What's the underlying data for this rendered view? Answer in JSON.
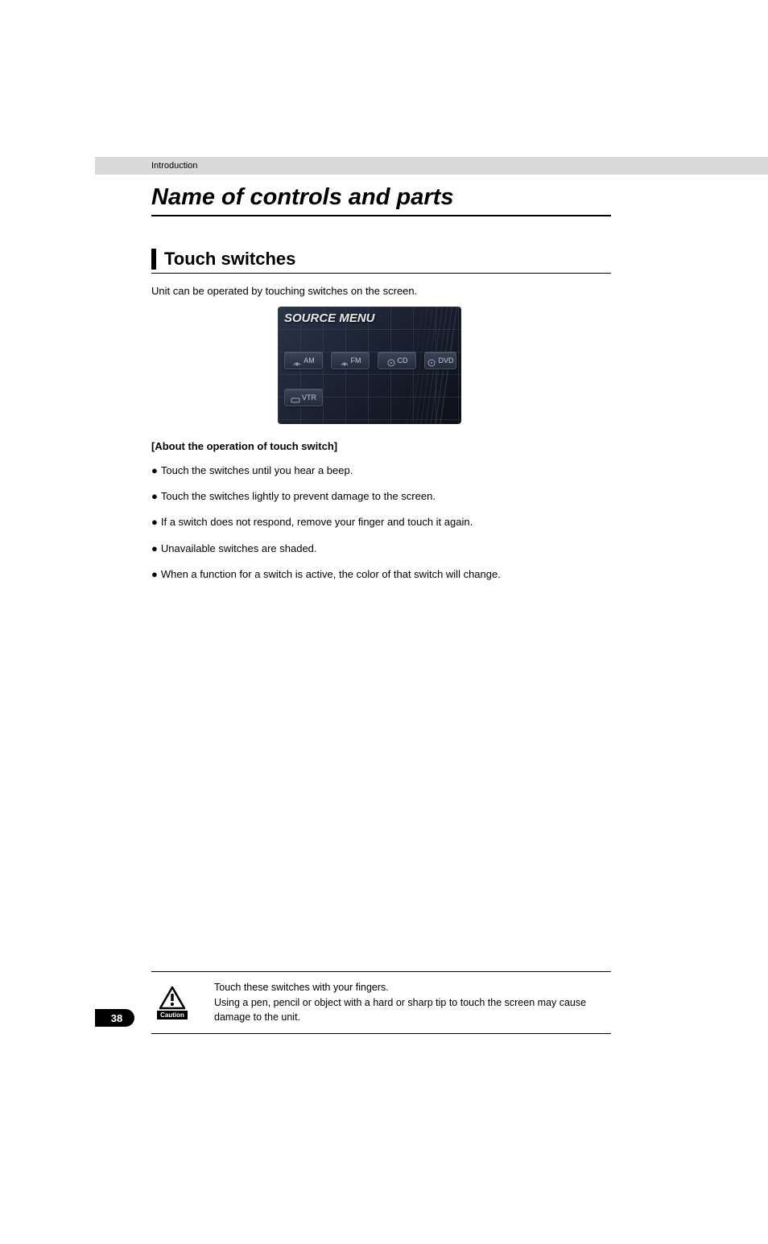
{
  "breadcrumb": "Introduction",
  "title": "Name of controls and parts",
  "section_title": "Touch switches",
  "intro": "Unit can be operated by touching switches on the screen.",
  "screen": {
    "title": "SOURCE MENU",
    "buttons": {
      "am": "AM",
      "fm": "FM",
      "cd": "CD",
      "dvd": "DVD",
      "vtr": "VTR"
    }
  },
  "subheading": "[About the operation of touch switch]",
  "bullets": [
    "Touch the switches until you hear a beep.",
    "Touch the switches lightly to prevent damage to the screen.",
    "If a switch does not respond, remove your finger and touch it again.",
    "Unavailable switches are shaded.",
    "When a function for a switch is active, the color of that switch will change."
  ],
  "caution": {
    "label": "Caution",
    "line1": "Touch these switches with your fingers.",
    "line2": "Using a pen, pencil or object with a hard or sharp tip to touch the screen may cause damage to the unit."
  },
  "page_number": "38"
}
